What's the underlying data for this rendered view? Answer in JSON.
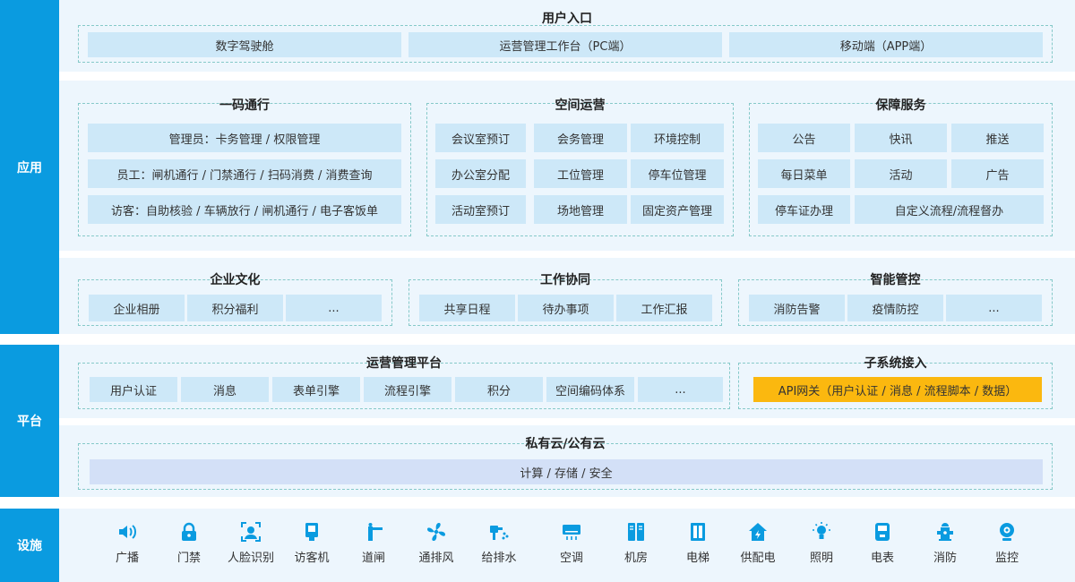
{
  "rails": {
    "application": "应用",
    "platform": "平台",
    "facility": "设施"
  },
  "user_entry": {
    "title": "用户入口",
    "items": [
      "数字驾驶舱",
      "运营管理工作台（PC端）",
      "移动端（APP端）"
    ]
  },
  "code_pass": {
    "title": "一码通行",
    "items": [
      "管理员：卡务管理 / 权限管理",
      "员工：闸机通行 / 门禁通行 / 扫码消费 / 消费查询",
      "访客：自助核验 / 车辆放行 / 闸机通行 / 电子客饭单"
    ]
  },
  "space_ops": {
    "title": "空间运营",
    "items": [
      "会议室预订",
      "会务管理",
      "环境控制",
      "办公室分配",
      "工位管理",
      "停车位管理",
      "活动室预订",
      "场地管理",
      "固定资产管理"
    ]
  },
  "support": {
    "title": "保障服务",
    "items": [
      "公告",
      "快讯",
      "推送",
      "每日菜单",
      "活动",
      "广告",
      "停车证办理",
      "自定义流程/流程督办"
    ]
  },
  "culture": {
    "title": "企业文化",
    "items": [
      "企业相册",
      "积分福利",
      "..."
    ]
  },
  "collab": {
    "title": "工作协同",
    "items": [
      "共享日程",
      "待办事项",
      "工作汇报"
    ]
  },
  "smart": {
    "title": "智能管控",
    "items": [
      "消防告警",
      "疫情防控",
      "..."
    ]
  },
  "ops_platform": {
    "title": "运营管理平台",
    "items": [
      "用户认证",
      "消息",
      "表单引擎",
      "流程引擎",
      "积分",
      "空间编码体系",
      "..."
    ]
  },
  "subsystem": {
    "title": "子系统接入",
    "item": "API网关（用户认证 / 消息 / 流程脚本 / 数据）"
  },
  "cloud": {
    "title": "私有云/公有云",
    "item": "计算 / 存储 / 安全"
  },
  "devices": [
    {
      "label": "广播",
      "icon": "speaker-icon"
    },
    {
      "label": "门禁",
      "icon": "lock-icon"
    },
    {
      "label": "人脸识别",
      "icon": "face-scan-icon"
    },
    {
      "label": "访客机",
      "icon": "kiosk-icon"
    },
    {
      "label": "道闸",
      "icon": "barrier-gate-icon"
    },
    {
      "label": "通排风",
      "icon": "fan-icon"
    },
    {
      "label": "给排水",
      "icon": "water-icon"
    },
    {
      "label": "空调",
      "icon": "air-conditioner-icon"
    },
    {
      "label": "机房",
      "icon": "server-room-icon"
    },
    {
      "label": "电梯",
      "icon": "elevator-icon"
    },
    {
      "label": "供配电",
      "icon": "power-supply-icon"
    },
    {
      "label": "照明",
      "icon": "lightbulb-icon"
    },
    {
      "label": "电表",
      "icon": "electric-meter-icon"
    },
    {
      "label": "消防",
      "icon": "fire-hydrant-icon"
    },
    {
      "label": "监控",
      "icon": "camera-icon"
    }
  ],
  "colors": {
    "rail": "#0a9be0",
    "band": "#edf6fd",
    "cell": "#cde8f8",
    "cell_lavender": "#d3e0f7",
    "highlight": "#fbb80f",
    "icon": "#0a9be0"
  }
}
